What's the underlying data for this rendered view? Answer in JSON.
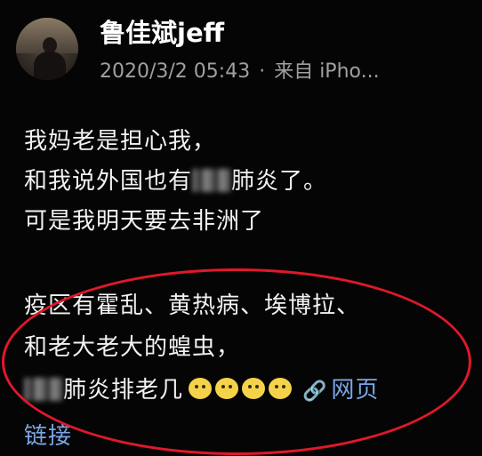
{
  "user": {
    "name": "鲁佳斌jeff",
    "date": "2020/3/2 05:43",
    "separator": "·",
    "source": "来自 iPho..."
  },
  "post": {
    "line1": "我妈老是担心我，",
    "line2_before": "和我说外国也有",
    "line2_after": "肺炎了。",
    "line3": "可是我明天要去非洲了",
    "line4": "疫区有霍乱、黄热病、埃博拉、",
    "line5": "和老大老大的蝗虫，",
    "line6_after": "肺炎排老几"
  },
  "link": {
    "label_part1": "网页",
    "label_part2": "链接"
  },
  "colors": {
    "background": "#050505",
    "link": "#7aa6e6",
    "annotation": "#e0182a",
    "meta": "#a0a0a0"
  },
  "icons": {
    "avatar": "user-avatar",
    "emoji": "doge-face-icon",
    "link": "chain-link-icon"
  }
}
